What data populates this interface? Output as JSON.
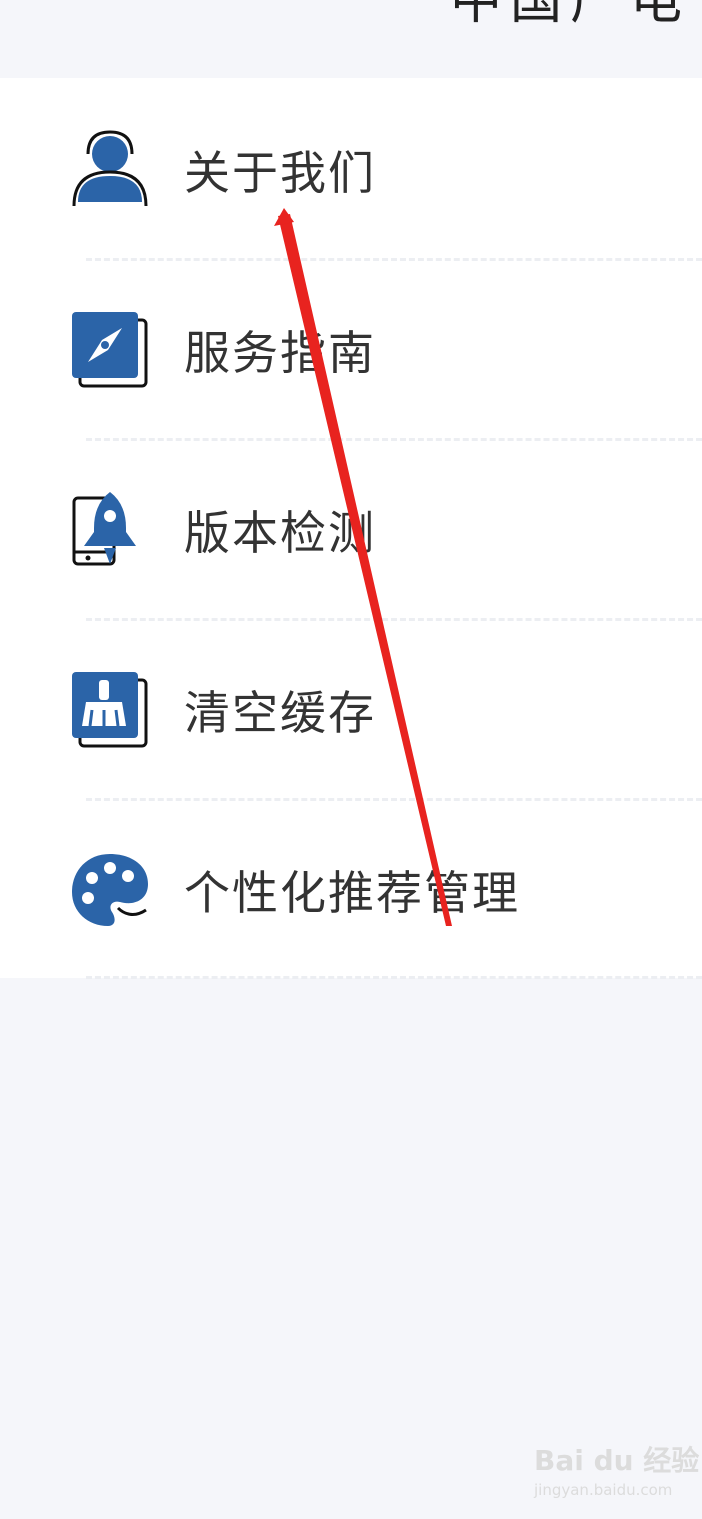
{
  "header": {
    "cut_title": "中国广电"
  },
  "menu": {
    "items": [
      {
        "label": "关于我们",
        "icon": "user-icon"
      },
      {
        "label": "服务指南",
        "icon": "compass-icon"
      },
      {
        "label": "版本检测",
        "icon": "rocket-phone-icon"
      },
      {
        "label": "清空缓存",
        "icon": "broom-icon"
      },
      {
        "label": "个性化推荐管理",
        "icon": "palette-icon"
      }
    ]
  },
  "watermark": {
    "logo": "Bai du 经验",
    "sub": "jingyan.baidu.com"
  },
  "colors": {
    "accent": "#2b64a8",
    "text": "#333333",
    "background": "#f5f6fa",
    "arrow": "#e8231f"
  }
}
